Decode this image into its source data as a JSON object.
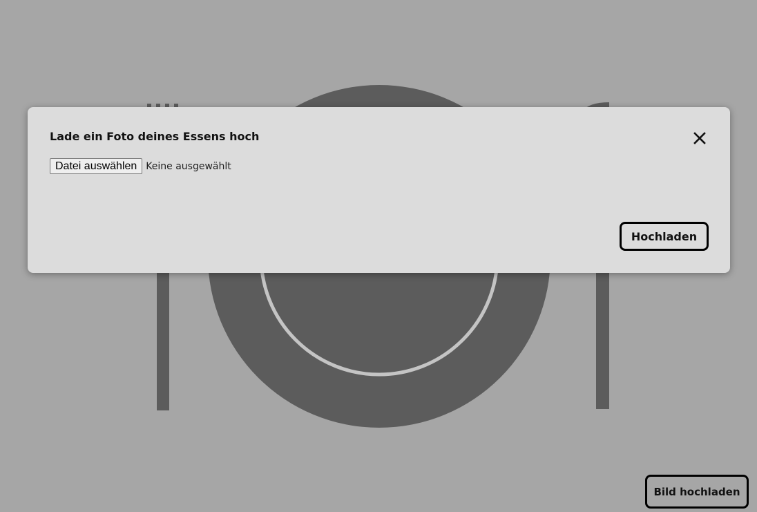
{
  "background": {
    "illustration_icon": "plate-fork-knife-icon",
    "upload_button_label": "Bild hochladen"
  },
  "modal": {
    "title": "Lade ein Foto deines Essens hoch",
    "close_icon": "close-icon",
    "file_input": {
      "button_label": "Datei auswählen",
      "status_text": "Keine ausgewählt"
    },
    "submit_label": "Hochladen"
  },
  "colors": {
    "overlay": "#a6a6a6",
    "illustration": "#5c5c5c",
    "plate_ring": "#c4c4c4",
    "modal_bg": "#dcdcdc",
    "border": "#000000"
  }
}
